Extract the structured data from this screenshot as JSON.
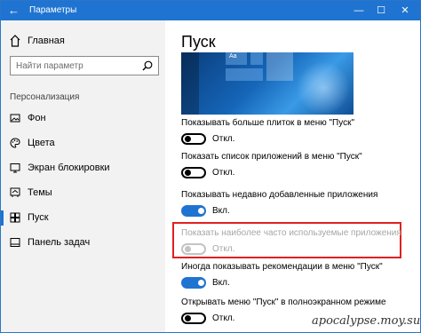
{
  "window": {
    "title": "Параметры",
    "accent": "#1f74d1"
  },
  "titlebar": {
    "back_icon": "←",
    "minimize_icon": "—",
    "maximize_icon": "☐",
    "close_icon": "✕"
  },
  "sidebar": {
    "home_label": "Главная",
    "search_placeholder": "Найти параметр",
    "section": "Персонализация",
    "items": [
      {
        "label": "Фон",
        "icon": "image-icon",
        "active": false
      },
      {
        "label": "Цвета",
        "icon": "palette-icon",
        "active": false
      },
      {
        "label": "Экран блокировки",
        "icon": "lock-screen-icon",
        "active": false
      },
      {
        "label": "Темы",
        "icon": "brush-icon",
        "active": false
      },
      {
        "label": "Пуск",
        "icon": "start-icon",
        "active": true
      },
      {
        "label": "Панель задач",
        "icon": "taskbar-icon",
        "active": false
      }
    ]
  },
  "main": {
    "title": "Пуск",
    "preview_tile_text": "Aa",
    "settings": [
      {
        "description": "Показывать больше плиток в меню \"Пуск\"",
        "state": "Откл.",
        "on": false,
        "enabled": true
      },
      {
        "description": "Показать список приложений в меню \"Пуск\"",
        "state": "Откл.",
        "on": false,
        "enabled": true
      },
      {
        "description": "Показывать недавно добавленные приложения",
        "state": "Вкл.",
        "on": true,
        "enabled": true
      },
      {
        "description": "Показать наиболее часто используемые приложения",
        "state": "Откл.",
        "on": false,
        "enabled": false
      },
      {
        "description": "Иногда показывать рекомендации в меню \"Пуск\"",
        "state": "Вкл.",
        "on": true,
        "enabled": true
      },
      {
        "description": "Открывать меню \"Пуск\" в полноэкранном режиме",
        "state": "Откл.",
        "on": false,
        "enabled": true
      }
    ]
  },
  "watermark": "apocalypse.moy.su"
}
